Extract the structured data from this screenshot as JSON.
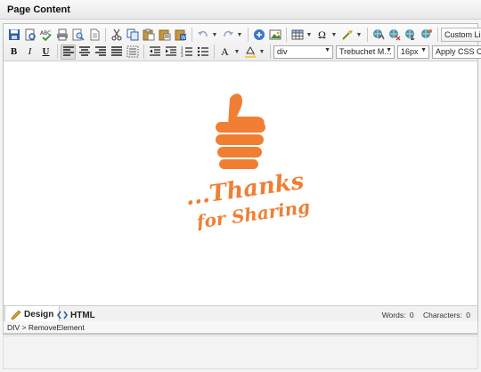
{
  "panel": {
    "title": "Page Content"
  },
  "toolbar": {
    "row1": [
      {
        "name": "save-icon",
        "label": "Save"
      },
      {
        "name": "print-preview-icon",
        "label": "Print Preview"
      },
      {
        "name": "spellcheck-icon",
        "label": "Spell Check"
      },
      {
        "name": "print-icon",
        "label": "Print"
      },
      {
        "name": "find-icon",
        "label": "Find"
      },
      {
        "name": "document-icon",
        "label": "Template"
      },
      {
        "name": "cut-icon",
        "label": "Cut"
      },
      {
        "name": "copy-icon",
        "label": "Copy"
      },
      {
        "name": "paste-icon",
        "label": "Paste"
      },
      {
        "name": "paste-text-icon",
        "label": "Paste Plain Text"
      },
      {
        "name": "paste-word-icon",
        "label": "Paste from Word"
      },
      {
        "name": "undo-icon",
        "label": "Undo"
      },
      {
        "name": "redo-icon",
        "label": "Redo"
      },
      {
        "name": "insert-icon",
        "label": "Insert"
      },
      {
        "name": "image-icon",
        "label": "Image"
      },
      {
        "name": "table-icon",
        "label": "Table"
      },
      {
        "name": "special-char-icon",
        "label": "Ω"
      },
      {
        "name": "format-painter-icon",
        "label": "Format"
      },
      {
        "name": "link-icon",
        "label": "Link"
      },
      {
        "name": "unlink-icon",
        "label": "Unlink"
      },
      {
        "name": "anchor-icon",
        "label": "Anchor"
      },
      {
        "name": "hyperlink-manager-icon",
        "label": "Hyperlink Manager"
      }
    ],
    "custom_links_label": "Custom Links",
    "bold": "B",
    "italic": "I",
    "underline": "U",
    "font_color_glyph": "A",
    "block_format": "div",
    "font_name": "Trebuchet M…",
    "font_size": "16px",
    "css_class": "Apply CSS Cl…"
  },
  "content": {
    "logo_line1": "...Thanks",
    "logo_line2": "for Sharing!",
    "accent_color": "#f07f34"
  },
  "modes": {
    "design": "Design",
    "html": "HTML"
  },
  "counts": {
    "words_label": "Words:",
    "words": "0",
    "chars_label": "Characters:",
    "chars": "0"
  },
  "status": {
    "path": "DIV > RemoveElement"
  },
  "colors": {
    "accent": "#f07f34",
    "toolbar_bg": "#ececec",
    "border": "#bdbdbd"
  }
}
